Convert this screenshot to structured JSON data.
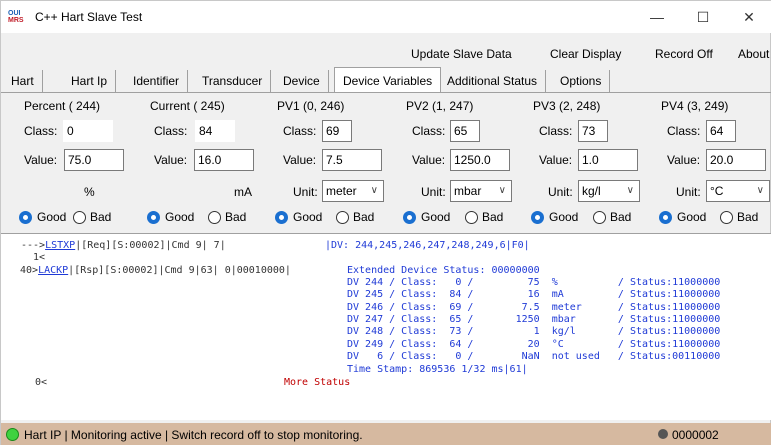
{
  "window": {
    "title": "C++ Hart Slave Test",
    "icon_text_top": "Ⓒ🄤",
    "icon_line1": "OUI",
    "icon_line2": "MRS",
    "minimize": "—",
    "maximize": "☐",
    "close": "✕"
  },
  "menu": {
    "update": "Update Slave Data",
    "clear": "Clear Display",
    "record": "Record Off",
    "about": "About"
  },
  "tabs": [
    "Hart",
    "Hart Ip",
    "Identifier",
    "Transducer",
    "Device",
    "Device Variables",
    "Additional Status",
    "Options"
  ],
  "groups": [
    {
      "title": "Percent ( 244)",
      "class_label": "Class:",
      "class_value": "0",
      "value_label": "Value:",
      "value": "75.0",
      "unit_label": "",
      "unit": "%",
      "good": "Good",
      "bad": "Bad",
      "selected": "Good"
    },
    {
      "title": "Current ( 245)",
      "class_label": "Class:",
      "class_value": "84",
      "value_label": "Value:",
      "value": "16.0",
      "unit_label": "",
      "unit": "mA",
      "good": "Good",
      "bad": "Bad",
      "selected": "Good"
    },
    {
      "title": "PV1 (0, 246)",
      "class_label": "Class:",
      "class_value": "69",
      "value_label": "Value:",
      "value": "7.5",
      "unit_label": "Unit:",
      "unit": "meter",
      "good": "Good",
      "bad": "Bad",
      "selected": "Good"
    },
    {
      "title": "PV2 (1, 247)",
      "class_label": "Class:",
      "class_value": "65",
      "value_label": "Value:",
      "value": "1250.0",
      "unit_label": "Unit:",
      "unit": "mbar",
      "good": "Good",
      "bad": "Bad",
      "selected": "Good"
    },
    {
      "title": "PV3 (2, 248)",
      "class_label": "Class:",
      "class_value": "73",
      "value_label": "Value:",
      "value": "1.0",
      "unit_label": "Unit:",
      "unit": "kg/l",
      "good": "Good",
      "bad": "Bad",
      "selected": "Good"
    },
    {
      "title": "PV4 (3, 249)",
      "class_label": "Class:",
      "class_value": "64",
      "value_label": "Value:",
      "value": "20.0",
      "unit_label": "Unit:",
      "unit": "°C",
      "good": "Good",
      "bad": "Bad",
      "selected": "Good"
    }
  ],
  "log": {
    "l1_prefix": "--->",
    "l1_link": "LSTXP",
    "l1_rest": "|[Req][S:00002]|Cmd 9| 7|",
    "l1_right": "|DV: 244,245,246,247,248,249,6|F0|",
    "l2": "  1<",
    "l3_prefix": "40>",
    "l3_link": "LACKP",
    "l3_rest": "|[Rsp][S:00002]|Cmd 9|63| 0|00010000|",
    "l3_right": "Extended Device Status: 00000000",
    "rows": [
      "DV 244 / Class:   0 /         75  %          / Status:11000000",
      "DV 245 / Class:  84 /         16  mA         / Status:11000000",
      "DV 246 / Class:  69 /        7.5  meter      / Status:11000000",
      "DV 247 / Class:  65 /       1250  mbar       / Status:11000000",
      "DV 248 / Class:  73 /          1  kg/l       / Status:11000000",
      "DV 249 / Class:  64 /         20  °C         / Status:11000000",
      "DV   6 / Class:   0 /        NaN  not used   / Status:00110000"
    ],
    "timestamp": "Time Stamp: 869536 1/32 ms|61|",
    "l_last": "0<",
    "more": "More Status"
  },
  "status": {
    "text": "Hart IP  | Monitoring active | Switch record off to stop monitoring.",
    "count": "0000002"
  }
}
